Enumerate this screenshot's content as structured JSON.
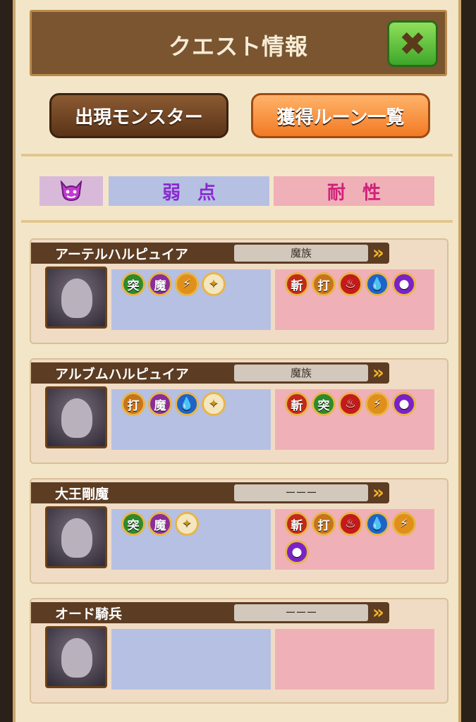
{
  "header": {
    "title": "クエスト情報"
  },
  "tabs": {
    "appear_label": "出現モンスター",
    "runes_label": "獲得ルーン一覧"
  },
  "legend": {
    "weak_label": "弱点",
    "resist_label": "耐性"
  },
  "colors": {
    "slash": "#c22b1a",
    "pierce": "#2f8a2a",
    "blunt": "#c7741a",
    "magic": "#8a2f9a",
    "fire": "#c41a1a",
    "water": "#1e63c9",
    "thunder": "#e0901a",
    "dark": "#7a22c6",
    "light": "#f4e7c0"
  },
  "monsters": [
    {
      "name": "アーテルハルピュイア",
      "tribe": "魔族",
      "weak": [
        {
          "t": "突",
          "c": "pierce"
        },
        {
          "t": "魔",
          "c": "magic"
        },
        {
          "t": "⚡",
          "c": "thunder"
        },
        {
          "t": "✦",
          "c": "light"
        }
      ],
      "resist": [
        {
          "t": "斬",
          "c": "slash"
        },
        {
          "t": "打",
          "c": "blunt"
        },
        {
          "t": "♨",
          "c": "fire"
        },
        {
          "t": "💧",
          "c": "water"
        },
        {
          "t": "●",
          "c": "dark"
        }
      ]
    },
    {
      "name": "アルブムハルピュイア",
      "tribe": "魔族",
      "weak": [
        {
          "t": "打",
          "c": "blunt"
        },
        {
          "t": "魔",
          "c": "magic"
        },
        {
          "t": "💧",
          "c": "water"
        },
        {
          "t": "✦",
          "c": "light"
        }
      ],
      "resist": [
        {
          "t": "斬",
          "c": "slash"
        },
        {
          "t": "突",
          "c": "pierce"
        },
        {
          "t": "♨",
          "c": "fire"
        },
        {
          "t": "⚡",
          "c": "thunder"
        },
        {
          "t": "●",
          "c": "dark"
        }
      ]
    },
    {
      "name": "大王剛魔",
      "tribe": "ーーー",
      "weak": [
        {
          "t": "突",
          "c": "pierce"
        },
        {
          "t": "魔",
          "c": "magic"
        },
        {
          "t": "✦",
          "c": "light"
        }
      ],
      "resist": [
        {
          "t": "斬",
          "c": "slash"
        },
        {
          "t": "打",
          "c": "blunt"
        },
        {
          "t": "♨",
          "c": "fire"
        },
        {
          "t": "💧",
          "c": "water"
        },
        {
          "t": "⚡",
          "c": "thunder"
        },
        {
          "t": "●",
          "c": "dark"
        }
      ]
    },
    {
      "name": "オード騎兵",
      "tribe": "ーーー",
      "weak": [],
      "resist": []
    }
  ]
}
